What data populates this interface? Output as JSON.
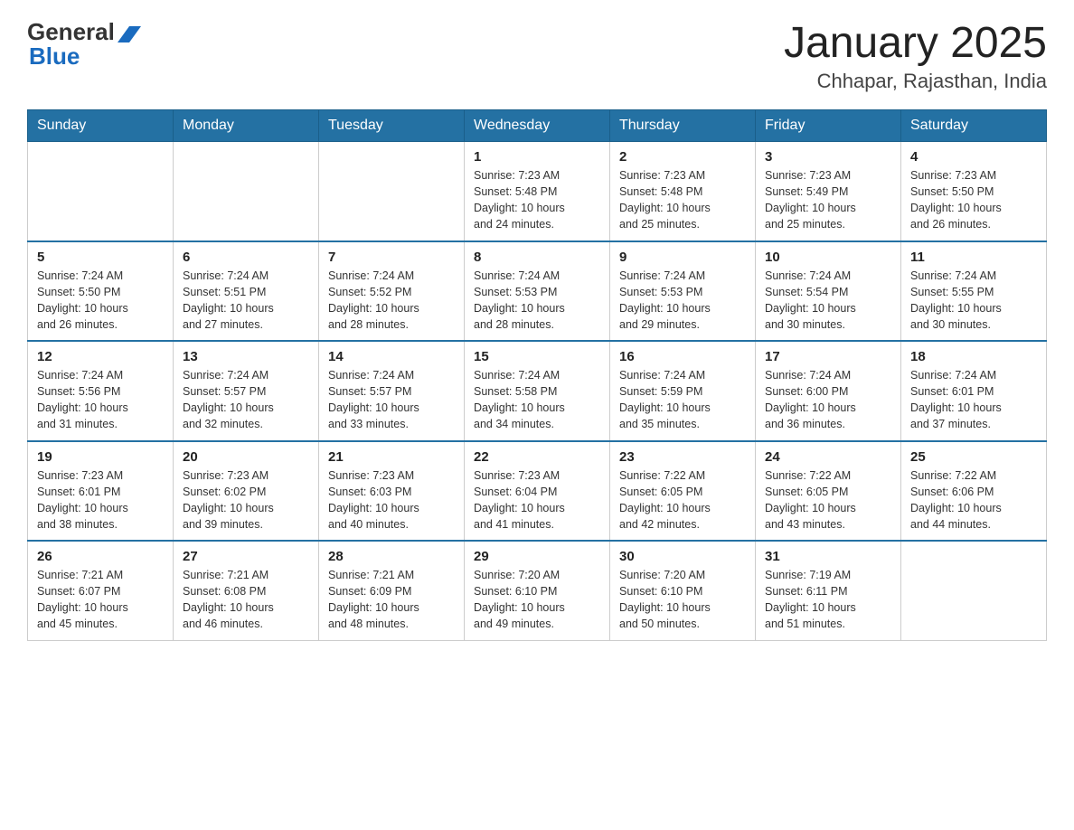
{
  "header": {
    "logo_text_general": "General",
    "logo_text_blue": "Blue",
    "month_title": "January 2025",
    "location": "Chhapar, Rajasthan, India"
  },
  "days_of_week": [
    "Sunday",
    "Monday",
    "Tuesday",
    "Wednesday",
    "Thursday",
    "Friday",
    "Saturday"
  ],
  "weeks": [
    [
      {
        "day": "",
        "info": ""
      },
      {
        "day": "",
        "info": ""
      },
      {
        "day": "",
        "info": ""
      },
      {
        "day": "1",
        "info": "Sunrise: 7:23 AM\nSunset: 5:48 PM\nDaylight: 10 hours\nand 24 minutes."
      },
      {
        "day": "2",
        "info": "Sunrise: 7:23 AM\nSunset: 5:48 PM\nDaylight: 10 hours\nand 25 minutes."
      },
      {
        "day": "3",
        "info": "Sunrise: 7:23 AM\nSunset: 5:49 PM\nDaylight: 10 hours\nand 25 minutes."
      },
      {
        "day": "4",
        "info": "Sunrise: 7:23 AM\nSunset: 5:50 PM\nDaylight: 10 hours\nand 26 minutes."
      }
    ],
    [
      {
        "day": "5",
        "info": "Sunrise: 7:24 AM\nSunset: 5:50 PM\nDaylight: 10 hours\nand 26 minutes."
      },
      {
        "day": "6",
        "info": "Sunrise: 7:24 AM\nSunset: 5:51 PM\nDaylight: 10 hours\nand 27 minutes."
      },
      {
        "day": "7",
        "info": "Sunrise: 7:24 AM\nSunset: 5:52 PM\nDaylight: 10 hours\nand 28 minutes."
      },
      {
        "day": "8",
        "info": "Sunrise: 7:24 AM\nSunset: 5:53 PM\nDaylight: 10 hours\nand 28 minutes."
      },
      {
        "day": "9",
        "info": "Sunrise: 7:24 AM\nSunset: 5:53 PM\nDaylight: 10 hours\nand 29 minutes."
      },
      {
        "day": "10",
        "info": "Sunrise: 7:24 AM\nSunset: 5:54 PM\nDaylight: 10 hours\nand 30 minutes."
      },
      {
        "day": "11",
        "info": "Sunrise: 7:24 AM\nSunset: 5:55 PM\nDaylight: 10 hours\nand 30 minutes."
      }
    ],
    [
      {
        "day": "12",
        "info": "Sunrise: 7:24 AM\nSunset: 5:56 PM\nDaylight: 10 hours\nand 31 minutes."
      },
      {
        "day": "13",
        "info": "Sunrise: 7:24 AM\nSunset: 5:57 PM\nDaylight: 10 hours\nand 32 minutes."
      },
      {
        "day": "14",
        "info": "Sunrise: 7:24 AM\nSunset: 5:57 PM\nDaylight: 10 hours\nand 33 minutes."
      },
      {
        "day": "15",
        "info": "Sunrise: 7:24 AM\nSunset: 5:58 PM\nDaylight: 10 hours\nand 34 minutes."
      },
      {
        "day": "16",
        "info": "Sunrise: 7:24 AM\nSunset: 5:59 PM\nDaylight: 10 hours\nand 35 minutes."
      },
      {
        "day": "17",
        "info": "Sunrise: 7:24 AM\nSunset: 6:00 PM\nDaylight: 10 hours\nand 36 minutes."
      },
      {
        "day": "18",
        "info": "Sunrise: 7:24 AM\nSunset: 6:01 PM\nDaylight: 10 hours\nand 37 minutes."
      }
    ],
    [
      {
        "day": "19",
        "info": "Sunrise: 7:23 AM\nSunset: 6:01 PM\nDaylight: 10 hours\nand 38 minutes."
      },
      {
        "day": "20",
        "info": "Sunrise: 7:23 AM\nSunset: 6:02 PM\nDaylight: 10 hours\nand 39 minutes."
      },
      {
        "day": "21",
        "info": "Sunrise: 7:23 AM\nSunset: 6:03 PM\nDaylight: 10 hours\nand 40 minutes."
      },
      {
        "day": "22",
        "info": "Sunrise: 7:23 AM\nSunset: 6:04 PM\nDaylight: 10 hours\nand 41 minutes."
      },
      {
        "day": "23",
        "info": "Sunrise: 7:22 AM\nSunset: 6:05 PM\nDaylight: 10 hours\nand 42 minutes."
      },
      {
        "day": "24",
        "info": "Sunrise: 7:22 AM\nSunset: 6:05 PM\nDaylight: 10 hours\nand 43 minutes."
      },
      {
        "day": "25",
        "info": "Sunrise: 7:22 AM\nSunset: 6:06 PM\nDaylight: 10 hours\nand 44 minutes."
      }
    ],
    [
      {
        "day": "26",
        "info": "Sunrise: 7:21 AM\nSunset: 6:07 PM\nDaylight: 10 hours\nand 45 minutes."
      },
      {
        "day": "27",
        "info": "Sunrise: 7:21 AM\nSunset: 6:08 PM\nDaylight: 10 hours\nand 46 minutes."
      },
      {
        "day": "28",
        "info": "Sunrise: 7:21 AM\nSunset: 6:09 PM\nDaylight: 10 hours\nand 48 minutes."
      },
      {
        "day": "29",
        "info": "Sunrise: 7:20 AM\nSunset: 6:10 PM\nDaylight: 10 hours\nand 49 minutes."
      },
      {
        "day": "30",
        "info": "Sunrise: 7:20 AM\nSunset: 6:10 PM\nDaylight: 10 hours\nand 50 minutes."
      },
      {
        "day": "31",
        "info": "Sunrise: 7:19 AM\nSunset: 6:11 PM\nDaylight: 10 hours\nand 51 minutes."
      },
      {
        "day": "",
        "info": ""
      }
    ]
  ]
}
